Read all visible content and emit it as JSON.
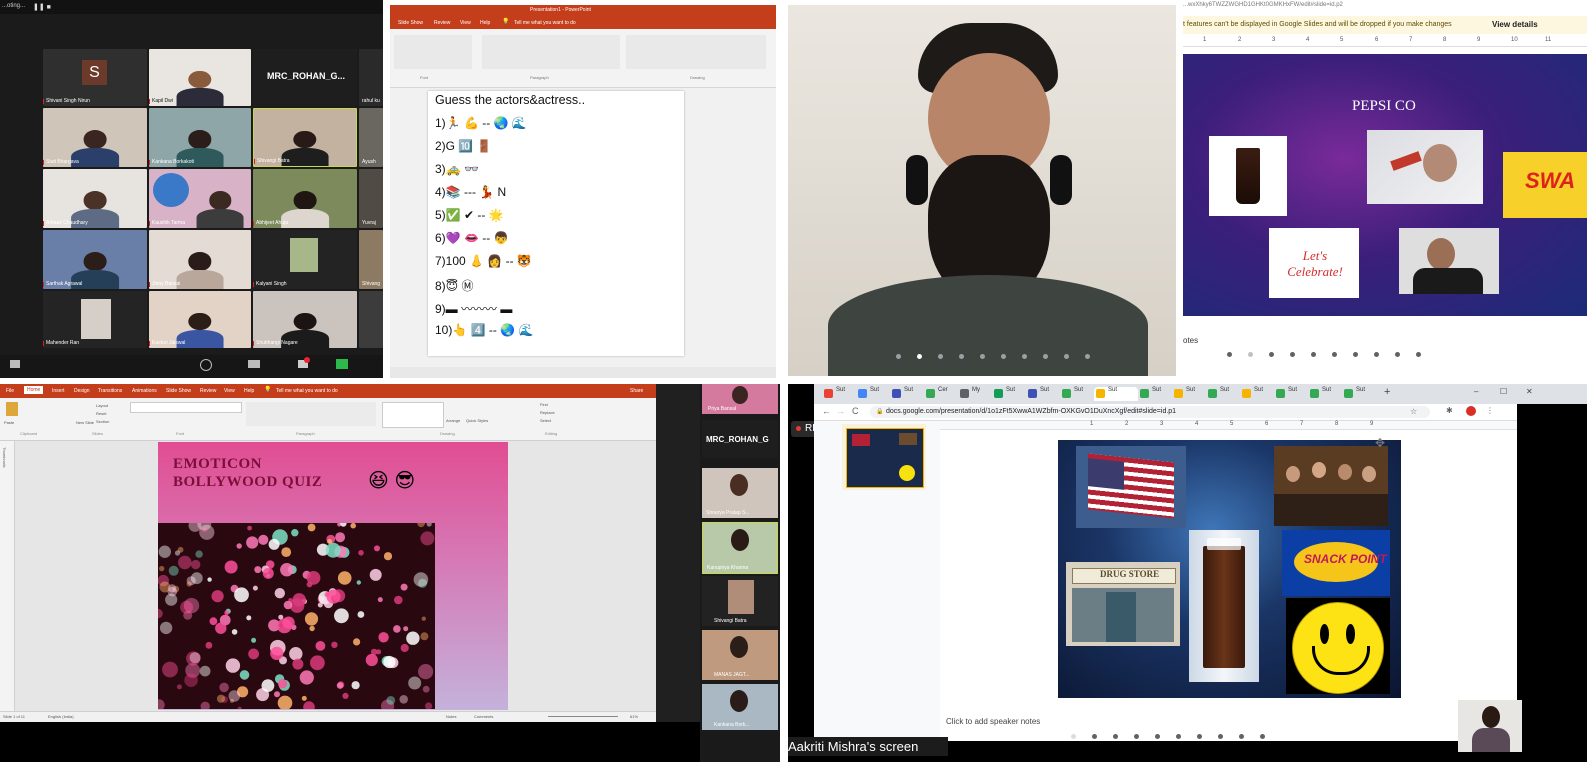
{
  "panel_zoom_gallery": {
    "window_title": "...oting...",
    "top_right_name": "MRC_ROHAN_G...",
    "avatar_letter": "S",
    "participants": [
      {
        "name": "Shivani Singh Nirun"
      },
      {
        "name": "Kapil Dwi"
      },
      {
        "name": "rahul ku"
      },
      {
        "name": "Stuti Bhargava"
      },
      {
        "name": "Kankana Borkakoti"
      },
      {
        "name": "Shivangi Batra"
      },
      {
        "name": "Ayush"
      },
      {
        "name": "Arbaaz Chaudhary"
      },
      {
        "name": "Kaushik Tarma"
      },
      {
        "name": "Abhijeet Ahuja"
      },
      {
        "name": "Yuvraj"
      },
      {
        "name": "Sarthak Agrawal"
      },
      {
        "name": "Jinny Bansal"
      },
      {
        "name": "Kalyani Singh"
      },
      {
        "name": "Shivang"
      },
      {
        "name": "Mahender Ran"
      },
      {
        "name": "Kasturi Jaiswal"
      },
      {
        "name": "Shubhangi Nagare"
      }
    ]
  },
  "panel_ppt_quiz": {
    "window_title": "Presentation1 - PowerPoint",
    "tabs": [
      "Slide Show",
      "Review",
      "View",
      "Help",
      "Tell me what you want to do"
    ],
    "groups": [
      "Font",
      "Paragraph",
      "Drawing"
    ],
    "slide_title": "Guess the actors&actress..",
    "lines": [
      {
        "num": "1)",
        "text": "🏃 💪 -- 🌏 🌊"
      },
      {
        "num": "2)",
        "text": "G 🔟 🚪"
      },
      {
        "num": "3)",
        "text": "🚕 👓"
      },
      {
        "num": "4)",
        "text": "📚 --- 💃 N"
      },
      {
        "num": "5)",
        "text": "✅ ✔ -- 🌟"
      },
      {
        "num": "6)",
        "text": "💜 👄 -- 👦"
      },
      {
        "num": "7)",
        "text": "100 👃 👩 -- 🐯"
      },
      {
        "num": "8)",
        "text": "😇 Ⓜ"
      },
      {
        "num": "9)",
        "text": "▬ 〰〰〰 ▬"
      },
      {
        "num": "10)",
        "text": "👆 4️⃣ -- 🌏 🌊"
      }
    ]
  },
  "panel_speaker": {
    "carousel_dots": 10,
    "active_dot": 1
  },
  "panel_pepsi": {
    "url_fragment": "...wxXhky6TWZZWGHD1GHKt0GMKHxFW/edit#slide=id.p2",
    "banner_text": "t features can't be displayed in Google Slides and will be dropped if you make changes",
    "banner_link": "View details",
    "ruler": [
      "1",
      "2",
      "3",
      "4",
      "5",
      "6",
      "7",
      "8",
      "9",
      "10",
      "11"
    ],
    "slide_title": "PEPSI CO",
    "notes_label": "otes",
    "celebrate_text": "Let's Celebrate!",
    "swag_text": "SWA",
    "carousel_dots": 10,
    "active_dot": 0
  },
  "panel_ppt_bollywood": {
    "tabs": [
      "File",
      "Home",
      "Insert",
      "Design",
      "Transitions",
      "Animations",
      "Slide Show",
      "Review",
      "View",
      "Help",
      "Tell me what you want to do"
    ],
    "share_label": "Share",
    "groups": [
      "Clipboard",
      "Slides",
      "Font",
      "Paragraph",
      "Drawing",
      "Editing"
    ],
    "ribbon_buttons": [
      "Paste",
      "New Slide",
      "Layout",
      "Reset",
      "Section",
      "Arrange",
      "Quick Styles",
      "Find",
      "Replace",
      "Select"
    ],
    "thumbnails_label": "Thumbnails",
    "slide_title_line1": "EMOTICON",
    "slide_title_line2": "BOLLYWOOD QUIZ",
    "title_emojis": "😆 😎",
    "status_left": "Slide 1 of 11",
    "status_lang": "English (India)",
    "status_notes": "Notes",
    "status_comments": "Comments",
    "zoom_label": "61%",
    "sidebar_names": [
      "Priya Bansal",
      "MRC_ROHAN_G",
      "Shourya Pratap S...",
      "Kanupriya Khanna",
      "Shivangi Batra",
      "MANAS JAGT...",
      "Kankana Bork..."
    ]
  },
  "panel_chrome_slides": {
    "rec_label": "REC",
    "tabs": [
      "Sut",
      "Sut",
      "Sut",
      "Cer",
      "My",
      "Sut",
      "Sut",
      "Sut",
      "Sut",
      "Sut",
      "Sut",
      "Sut",
      "Sut",
      "Sut",
      "Sut",
      "Sut"
    ],
    "url": "docs.google.com/presentation/d/1o1zFt5XwwA1WZbfm-OXKGvO1DuXncXgf/edit#slide=id.p1",
    "ruler": [
      "1",
      "2",
      "3",
      "4",
      "5",
      "6",
      "7",
      "8",
      "9"
    ],
    "drug_store_sign": "DRUG STORE",
    "snack_point_text": "SNACK POINT",
    "speaker_notes": "Click to add speaker notes",
    "screen_share_label": "Aakriti Mishra's screen",
    "carousel_dots": 10,
    "active_dot": 1
  }
}
